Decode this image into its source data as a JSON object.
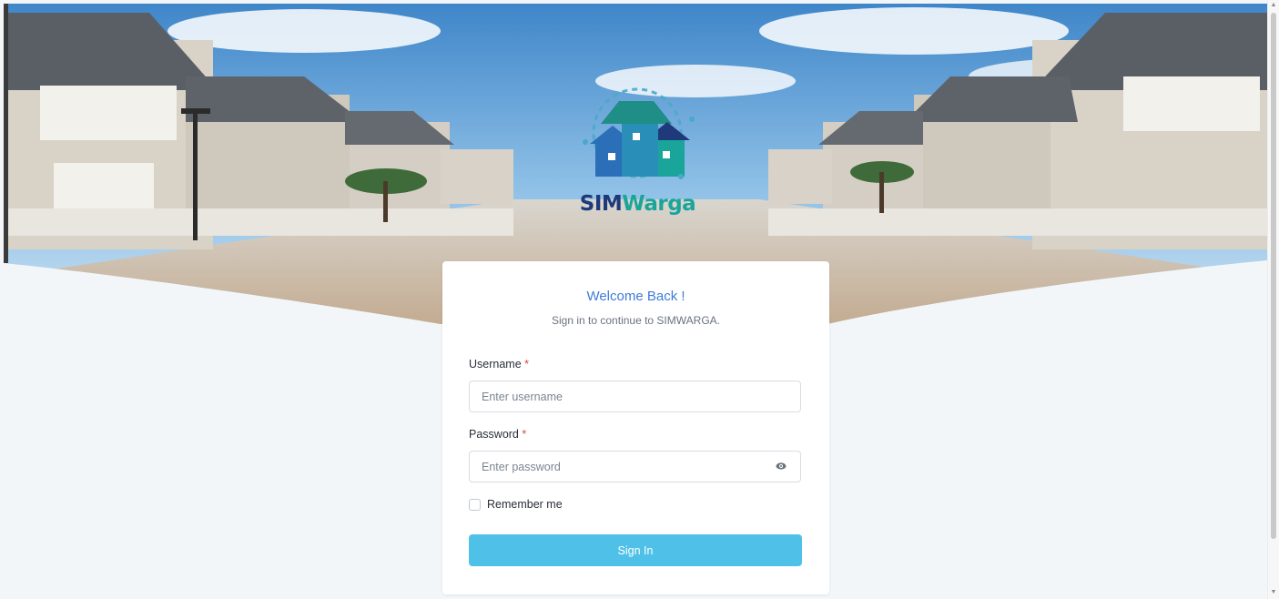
{
  "brand": {
    "logo_part1": "SIM",
    "logo_part2": "Warga",
    "logo_colors": {
      "primary": "#1f3a7a",
      "accent": "#1aa59b"
    }
  },
  "login": {
    "title": "Welcome Back !",
    "subtitle": "Sign in to continue to SIMWARGA.",
    "username_label": "Username",
    "username_placeholder": "Enter username",
    "password_label": "Password",
    "password_placeholder": "Enter password",
    "required_mark": "*",
    "remember_label": "Remember me",
    "submit_label": "Sign In",
    "accent_color": "#3f7bd8",
    "button_color": "#4fc1e8"
  },
  "icons": {
    "password_toggle": "eye-icon",
    "scroll_up": "chevron-up-icon",
    "scroll_down": "chevron-down-icon"
  }
}
